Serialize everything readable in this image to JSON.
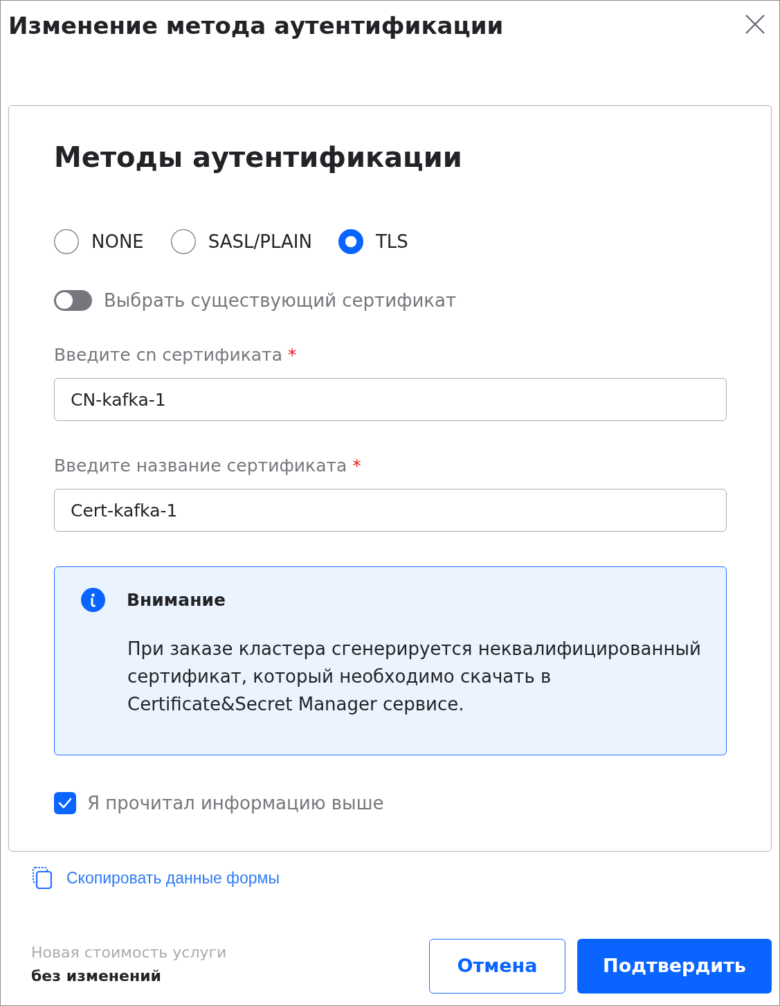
{
  "dialog": {
    "title": "Изменение метода аутентификации"
  },
  "card": {
    "heading": "Методы аутентификации",
    "auth_methods": [
      {
        "label": "NONE",
        "selected": false
      },
      {
        "label": "SASL/PLAIN",
        "selected": false
      },
      {
        "label": "TLS",
        "selected": true
      }
    ],
    "toggle": {
      "label": "Выбрать существующий сертификат",
      "on": false
    },
    "fields": [
      {
        "label": "Введите cn сертификата",
        "required_mark": "*",
        "value": "CN-kafka-1"
      },
      {
        "label": "Введите название сертификата",
        "required_mark": "*",
        "value": "Cert-kafka-1"
      }
    ],
    "alert": {
      "title": "Внимание",
      "text": "При заказе кластера сгенерируется неквалифицированный сертификат, который необходимо скачать в Certificate&Secret Manager сервисе."
    },
    "confirm_checkbox": {
      "label": "Я прочитал информацию выше",
      "checked": true
    }
  },
  "copy_link": {
    "label": "Скопировать данные формы"
  },
  "footer": {
    "price_label": "Новая стоимость услуги",
    "price_value": "без изменений",
    "buttons": [
      {
        "label": "Отмена",
        "kind": "secondary"
      },
      {
        "label": "Подтвердить",
        "kind": "primary"
      }
    ]
  }
}
